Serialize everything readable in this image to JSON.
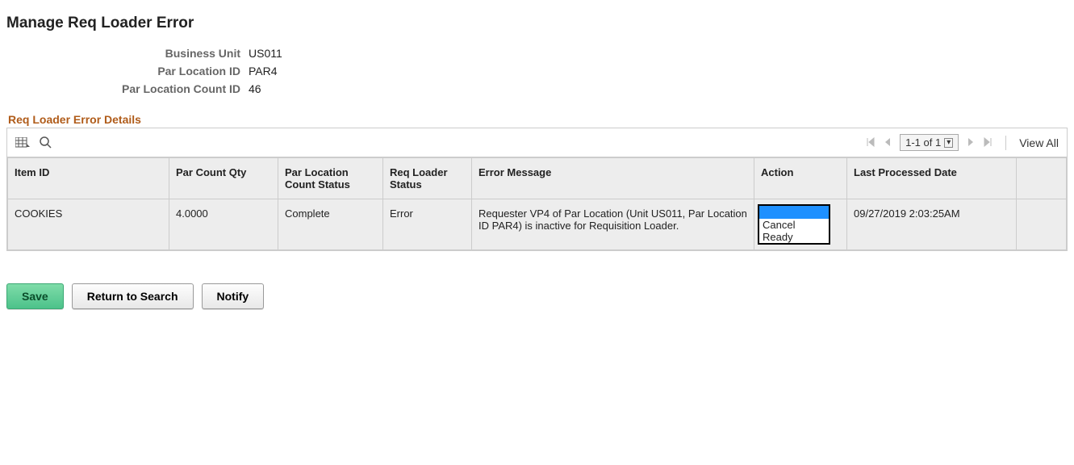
{
  "page_title": "Manage Req Loader Error",
  "meta": {
    "business_unit_label": "Business Unit",
    "business_unit_value": "US011",
    "par_location_id_label": "Par Location ID",
    "par_location_id_value": "PAR4",
    "par_location_count_id_label": "Par Location Count ID",
    "par_location_count_id_value": "46"
  },
  "section_title": "Req Loader Error Details",
  "grid": {
    "range_text": "1-1 of 1",
    "view_all_label": "View All",
    "columns": {
      "item_id": "Item ID",
      "par_count_qty": "Par Count Qty",
      "par_loc_status": "Par Location Count Status",
      "req_loader_status": "Req Loader Status",
      "error_message": "Error Message",
      "action": "Action",
      "last_processed": "Last Processed Date"
    },
    "rows": [
      {
        "item_id": "COOKIES",
        "par_count_qty": "4.0000",
        "par_loc_status": "Complete",
        "req_loader_status": "Error",
        "error_message": "Requester VP4 of Par Location (Unit US011, Par Location ID PAR4) is inactive for Requisition Loader.",
        "action_options": [
          "",
          "Cancel",
          "Ready"
        ],
        "action_selected": "",
        "last_processed": "09/27/2019  2:03:25AM"
      }
    ]
  },
  "buttons": {
    "save": "Save",
    "return": "Return to Search",
    "notify": "Notify"
  }
}
